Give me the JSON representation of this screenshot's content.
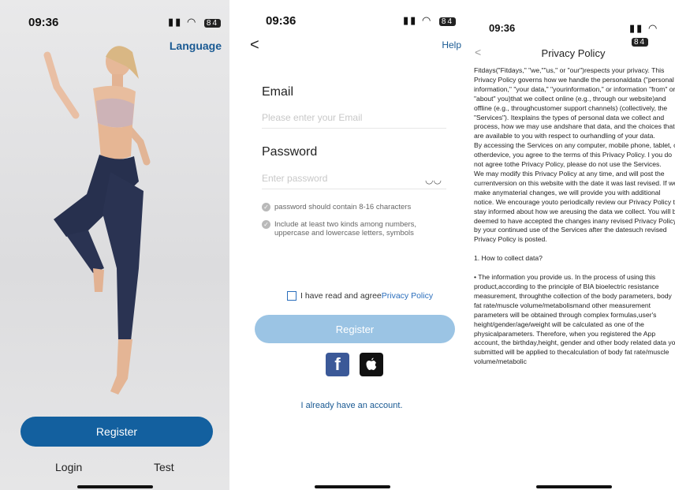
{
  "panel1": {
    "time": "09:36",
    "language_label": "Language",
    "register_label": "Register",
    "login_label": "Login",
    "test_label": "Test",
    "battery": "84"
  },
  "panel2": {
    "time": "09:36",
    "back_glyph": "<",
    "help_label": "Help",
    "email_title": "Email",
    "email_placeholder": "Please enter your Email",
    "password_title": "Password",
    "password_placeholder": "Enter password",
    "rule1": "password should contain 8-16 characters",
    "rule2": "Include at least two kinds among numbers, uppercase and lowercase letters, symbols",
    "agree_text": "I have read and agree",
    "agree_link": "Privacy Policy",
    "register_label": "Register",
    "already_label": "I already have an account.",
    "battery": "84"
  },
  "panel3": {
    "time": "09:36",
    "title": "Privacy Policy",
    "back_glyph": "<",
    "battery": "84",
    "paragraphs": [
      "Fitdays(\"Fitdays,\" \"we,\"\"us,\" or \"our\")respects your privacy. This Privacy Policy governs how we handle the personaldata (\"personal information,\" \"your data,\" \"yourinformation,\" or information \"from\" or \"about\" you)that we collect online (e.g., through our website)and offline (e.g., throughcustomer support channels) (collectively, the \"Services\"). Itexplains the types of personal data we collect and process, how we may use andshare that data, and the choices that are available to you with respect to ourhandling of your data.",
      "By accessing the Services on any computer, mobile phone, tablet, or otherdevice, you agree to the terms of this Privacy Policy. I you do not agree tothe Privacy Policy, please do not use the Services.",
      "We may modify this Privacy Policy at any time, and will post the currentversion on this website with the date it was last revised. If we make anymaterial changes, we will provide you with additional notice. We encourage youto periodically review our Privacy Policy to stay informed about how we areusing the data we collect. You will be deemed to have accepted the changes inany revised Privacy Policy by your continued use of the Services after the datesuch revised Privacy Policy is posted.",
      "1. How to collect data?",
      "• The information you provide us. In the process of using this product,according to the principle of BIA bioelectric resistance measurement, throughthe collection of the body parameters, body fat rate/muscle volume/metabolismand other measurement parameters will be obtained through complex formulas,user's height/gender/age/weight will be calculated as one of the physicalparameters. Therefore, when you registered the App account, the birthday,height, gender and other body related data you submitted will be applied to thecalculation of body fat rate/muscle volume/metabolic"
    ]
  }
}
